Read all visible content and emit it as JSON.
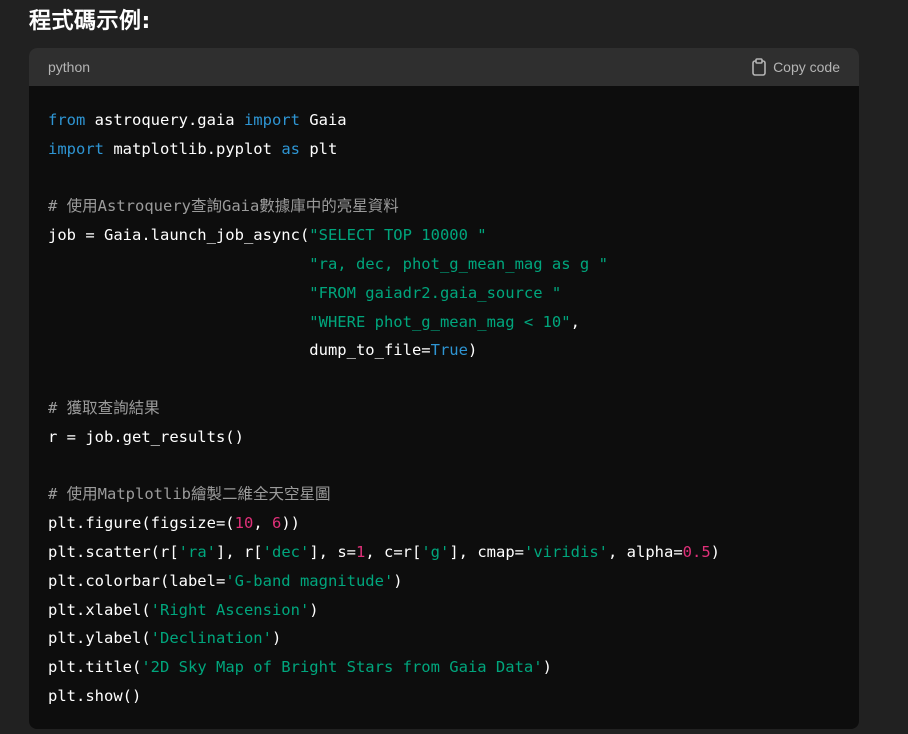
{
  "heading": "程式碼示例:",
  "code_block": {
    "language": "python",
    "copy_label": "Copy code",
    "lines": [
      [
        {
          "t": "kw",
          "v": "from"
        },
        {
          "t": "p",
          "v": " astroquery.gaia "
        },
        {
          "t": "kw",
          "v": "import"
        },
        {
          "t": "p",
          "v": " Gaia"
        }
      ],
      [
        {
          "t": "kw",
          "v": "import"
        },
        {
          "t": "p",
          "v": " matplotlib.pyplot "
        },
        {
          "t": "kw",
          "v": "as"
        },
        {
          "t": "p",
          "v": " plt"
        }
      ],
      [],
      [
        {
          "t": "cm",
          "v": "# 使用Astroquery查詢Gaia數據庫中的亮星資料"
        }
      ],
      [
        {
          "t": "p",
          "v": "job = Gaia.launch_job_async("
        },
        {
          "t": "st",
          "v": "\"SELECT TOP 10000 \""
        }
      ],
      [
        {
          "t": "p",
          "v": "                            "
        },
        {
          "t": "st",
          "v": "\"ra, dec, phot_g_mean_mag as g \""
        }
      ],
      [
        {
          "t": "p",
          "v": "                            "
        },
        {
          "t": "st",
          "v": "\"FROM gaiadr2.gaia_source \""
        }
      ],
      [
        {
          "t": "p",
          "v": "                            "
        },
        {
          "t": "st",
          "v": "\"WHERE phot_g_mean_mag < 10\""
        },
        {
          "t": "p",
          "v": ","
        }
      ],
      [
        {
          "t": "p",
          "v": "                            dump_to_file="
        },
        {
          "t": "kw",
          "v": "True"
        },
        {
          "t": "p",
          "v": ")"
        }
      ],
      [],
      [
        {
          "t": "cm",
          "v": "# 獲取查詢結果"
        }
      ],
      [
        {
          "t": "p",
          "v": "r = job.get_results()"
        }
      ],
      [],
      [
        {
          "t": "cm",
          "v": "# 使用Matplotlib繪製二維全天空星圖"
        }
      ],
      [
        {
          "t": "p",
          "v": "plt.figure(figsize=("
        },
        {
          "t": "nu",
          "v": "10"
        },
        {
          "t": "p",
          "v": ", "
        },
        {
          "t": "nu",
          "v": "6"
        },
        {
          "t": "p",
          "v": "))"
        }
      ],
      [
        {
          "t": "p",
          "v": "plt.scatter(r["
        },
        {
          "t": "st",
          "v": "'ra'"
        },
        {
          "t": "p",
          "v": "], r["
        },
        {
          "t": "st",
          "v": "'dec'"
        },
        {
          "t": "p",
          "v": "], s="
        },
        {
          "t": "nu",
          "v": "1"
        },
        {
          "t": "p",
          "v": ", c=r["
        },
        {
          "t": "st",
          "v": "'g'"
        },
        {
          "t": "p",
          "v": "], cmap="
        },
        {
          "t": "st",
          "v": "'viridis'"
        },
        {
          "t": "p",
          "v": ", alpha="
        },
        {
          "t": "nu",
          "v": "0.5"
        },
        {
          "t": "p",
          "v": ")"
        }
      ],
      [
        {
          "t": "p",
          "v": "plt.colorbar(label="
        },
        {
          "t": "st",
          "v": "'G-band magnitude'"
        },
        {
          "t": "p",
          "v": ")"
        }
      ],
      [
        {
          "t": "p",
          "v": "plt.xlabel("
        },
        {
          "t": "st",
          "v": "'Right Ascension'"
        },
        {
          "t": "p",
          "v": ")"
        }
      ],
      [
        {
          "t": "p",
          "v": "plt.ylabel("
        },
        {
          "t": "st",
          "v": "'Declination'"
        },
        {
          "t": "p",
          "v": ")"
        }
      ],
      [
        {
          "t": "p",
          "v": "plt.title("
        },
        {
          "t": "st",
          "v": "'2D Sky Map of Bright Stars from Gaia Data'"
        },
        {
          "t": "p",
          "v": ")"
        }
      ],
      [
        {
          "t": "p",
          "v": "plt.show()"
        }
      ]
    ]
  },
  "colors": {
    "page_bg": "#212121",
    "code_bg": "#0d0d0d",
    "header_bg": "#2f2f2f",
    "keyword": "#2e95d3",
    "comment": "#9b9b9b",
    "string": "#00a67d",
    "number": "#df3079"
  },
  "icons": {
    "copy": "clipboard-icon"
  }
}
